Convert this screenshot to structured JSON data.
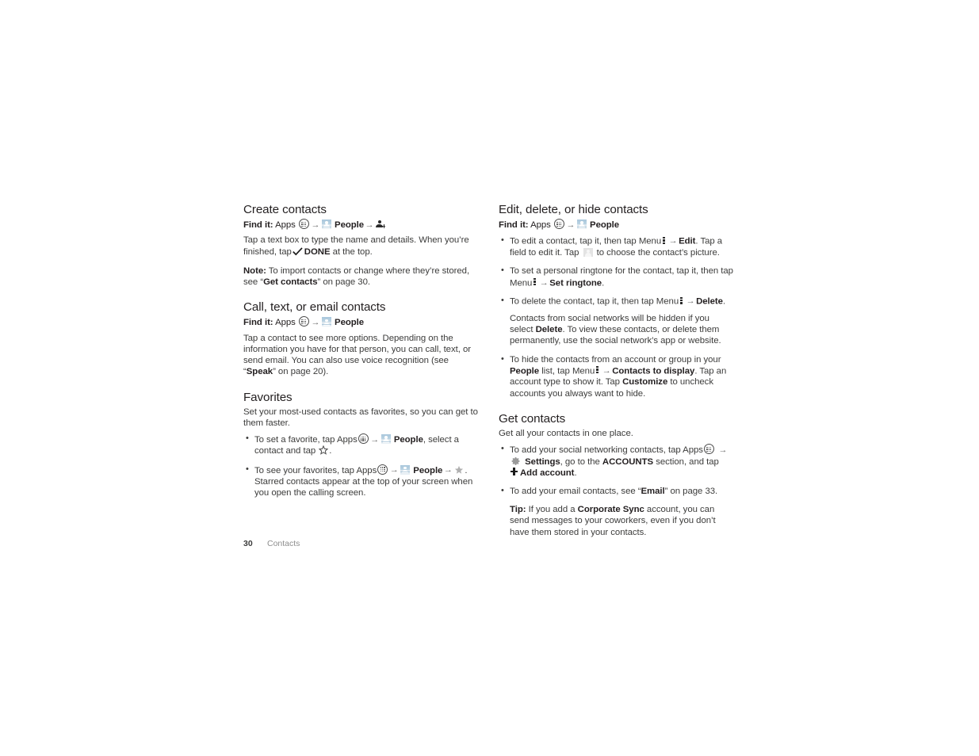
{
  "page": {
    "number": "30",
    "chapter": "Contacts"
  },
  "icons": {
    "apps": "apps-grid-icon",
    "people": "people-app-icon",
    "add_person": "add-person-icon",
    "photo": "contact-photo-placeholder-icon",
    "menu": "menu-overflow-icon",
    "star_outline": "star-outline-icon",
    "star_filled": "star-filled-icon",
    "gear": "settings-gear-icon",
    "plus": "plus-icon",
    "check": "check-icon",
    "arrow": "→"
  },
  "labels": {
    "find_it": "Find it:",
    "apps": "Apps",
    "people": "People",
    "note": "Note:",
    "tip": "Tip:"
  },
  "left_column": {
    "create_contacts": {
      "heading": "Create contacts",
      "findit_prefix": "Find it:",
      "findit_apps": "Apps",
      "findit_people": "People",
      "body_1a": "Tap a text box to type the name and details. When you’re finished, tap",
      "body_1_done": "DONE",
      "body_1b": "at the top.",
      "note_label": "Note:",
      "note_a": "To import contacts or change where they’re stored, see “",
      "note_bold": "Get contacts",
      "note_b": "” on page 30."
    },
    "call_text_email": {
      "heading": "Call, text, or email contacts",
      "findit_prefix": "Find it:",
      "findit_apps": "Apps",
      "findit_people": "People",
      "body_a": "Tap a contact to see more options. Depending on the information you have for that person, you can call, text, or send email. You can also use voice recognition (see “",
      "body_bold": "Speak",
      "body_b": "” on page 20)."
    },
    "favorites": {
      "heading": "Favorites",
      "intro": "Set your most-used contacts as favorites, so you can get to them faster.",
      "bullet_1a": "To set a favorite, tap Apps",
      "bullet_1_people": "People",
      "bullet_1b": ", select a contact and tap",
      "bullet_1c": ".",
      "bullet_2a": "To see your favorites, tap Apps",
      "bullet_2_people": "People",
      "bullet_2b": ".",
      "bullet_2c": "Starred contacts appear at the top of your screen when you open the calling screen."
    }
  },
  "right_column": {
    "edit_delete_hide": {
      "heading": "Edit, delete, or hide contacts",
      "findit_prefix": "Find it:",
      "findit_apps": "Apps",
      "findit_people": "People",
      "bullet_1a": "To edit a contact, tap it, then tap Menu",
      "bullet_1_edit": "Edit",
      "bullet_1b": ". Tap a field to edit it. Tap",
      "bullet_1c": "to choose the contact’s picture.",
      "bullet_2a": "To set a personal ringtone for the contact, tap it, then tap Menu",
      "bullet_2_bold": "Set ringtone",
      "bullet_2b": ".",
      "bullet_3a": "To delete the contact, tap it, then tap Menu",
      "bullet_3_bold": "Delete",
      "bullet_3b": ".",
      "bullet_3_sub_a": "Contacts from social networks will be hidden if you select",
      "bullet_3_sub_bold": "Delete",
      "bullet_3_sub_b": ". To view these contacts, or delete them permanently, use the social network’s app or website.",
      "bullet_4a": "To hide the contacts from an account or group in your",
      "bullet_4_people": "People",
      "bullet_4b": "list, tap Menu",
      "bullet_4_bold": "Contacts to display",
      "bullet_4c": ". Tap an account type to show it. Tap",
      "bullet_4_customize": "Customize",
      "bullet_4d": "to uncheck accounts you always want to hide."
    },
    "get_contacts": {
      "heading": "Get contacts",
      "intro": "Get all your contacts in one place.",
      "bullet_1a": "To add your social networking contacts, tap Apps",
      "bullet_1_settings": "Settings",
      "bullet_1b": ", go to the",
      "bullet_1_accounts": "ACCOUNTS",
      "bullet_1c": "section, and tap",
      "bullet_1_add": "Add account",
      "bullet_1d": ".",
      "bullet_2a": "To add your email contacts, see “",
      "bullet_2_email": "Email",
      "bullet_2b": "” on page 33.",
      "tip_label": "Tip:",
      "tip_a": "If you add a",
      "tip_bold": "Corporate Sync",
      "tip_b": "account, you can send messages to your coworkers, even if you don’t have them stored in your contacts."
    }
  }
}
